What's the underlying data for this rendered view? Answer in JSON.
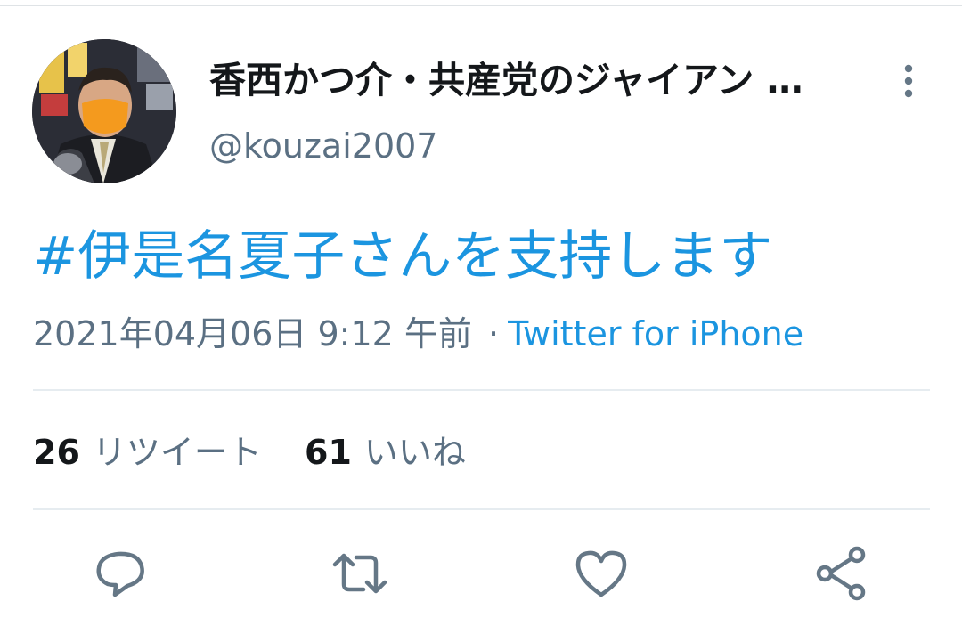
{
  "tweet": {
    "author": {
      "display_name": "香西かつ介・共産党のジャイアン …",
      "handle": "@kouzai2007"
    },
    "text": "#伊是名夏子さんを支持します",
    "timestamp": "2021年04月06日 9:12 午前",
    "separator": "·",
    "source": "Twitter for iPhone",
    "stats": {
      "retweets_count": "26",
      "retweets_label": "リツイート",
      "likes_count": "61",
      "likes_label": "いいね"
    }
  },
  "icons": {
    "more": "more-vertical-icon",
    "reply": "reply-icon",
    "retweet": "retweet-icon",
    "like": "like-icon",
    "share": "share-icon"
  },
  "colors": {
    "link": "#1b95e0",
    "icon": "#657786",
    "text": "#14171a",
    "secondary": "#5b7083",
    "divider": "#e6ecf0"
  }
}
